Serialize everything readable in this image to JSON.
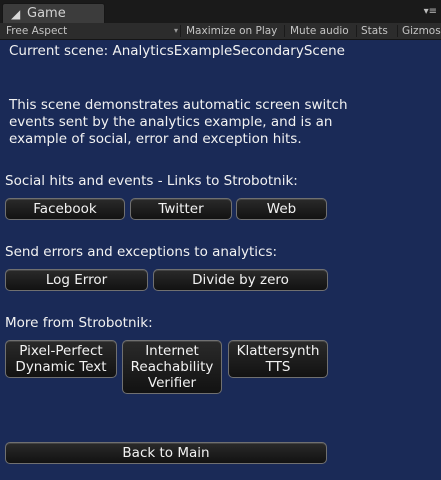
{
  "tab": {
    "icon": "unity-game-icon",
    "label": "Game",
    "menu_glyph": "▾≡"
  },
  "toolbar": {
    "aspect": "Free Aspect",
    "maximize": "Maximize on Play",
    "mute": "Mute audio",
    "stats": "Stats",
    "gizmos": "Gizmos"
  },
  "scene": {
    "title": "Current scene: AnalyticsExampleSecondaryScene",
    "description": "This scene demonstrates automatic screen switch\nevents sent by the analytics example, and is an\nexample of social, error and exception hits."
  },
  "social": {
    "heading": "Social hits and events - Links to Strobotnik:",
    "facebook": "Facebook",
    "twitter": "Twitter",
    "web": "Web"
  },
  "errors": {
    "heading": "Send errors and exceptions to analytics:",
    "log_error": "Log Error",
    "divide_by_zero": "Divide by zero"
  },
  "more": {
    "heading": "More from Strobotnik:",
    "pixel_perfect": "Pixel-Perfect\nDynamic Text",
    "reachability": "Internet\nReachability\nVerifier",
    "klattersynth": "Klattersynth\nTTS"
  },
  "back_button": "Back to Main",
  "colors": {
    "viewport_bg": "#1a2a57",
    "button_bg": "#1c1c1c",
    "button_border": "#707070",
    "text": "#f2f2f2"
  }
}
